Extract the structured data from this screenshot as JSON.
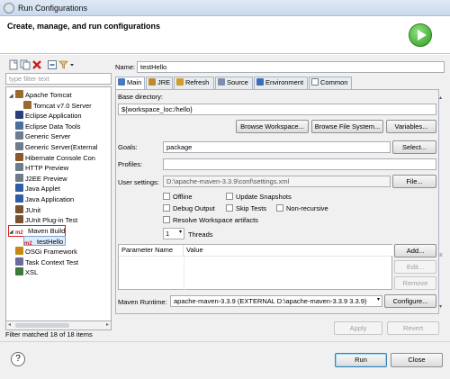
{
  "window": {
    "title": "Run Configurations"
  },
  "banner": {
    "heading": "Create, manage, and run configurations"
  },
  "left": {
    "filter_placeholder": "type filter text",
    "filter_status": "Filter matched 18 of 18 items",
    "tree": [
      {
        "label": "Apache Tomcat",
        "level": 1,
        "expanded": true,
        "icon_color": "#9a6b2f"
      },
      {
        "label": "Tomcat v7.0 Server",
        "level": 2,
        "icon_color": "#9a6b2f"
      },
      {
        "label": "Eclipse Application",
        "level": 1,
        "icon_color": "#2a3f7a"
      },
      {
        "label": "Eclipse Data Tools",
        "level": 1,
        "icon_color": "#4b6f9e"
      },
      {
        "label": "Generic Server",
        "level": 1,
        "icon_color": "#6f7c8c"
      },
      {
        "label": "Generic Server(External",
        "level": 1,
        "icon_color": "#6f7c8c"
      },
      {
        "label": "Hibernate Console Con",
        "level": 1,
        "icon_color": "#8b5a2b"
      },
      {
        "label": "HTTP Preview",
        "level": 1,
        "icon_color": "#6f7c8c"
      },
      {
        "label": "J2EE Preview",
        "level": 1,
        "icon_color": "#6f7c8c"
      },
      {
        "label": "Java Applet",
        "level": 1,
        "icon_color": "#2f5ea8"
      },
      {
        "label": "Java Application",
        "level": 1,
        "icon_color": "#2f5ea8"
      },
      {
        "label": "JUnit",
        "level": 1,
        "icon_color": "#7a5230"
      },
      {
        "label": "JUnit Plug-in Test",
        "level": 1,
        "icon_color": "#7a5230"
      },
      {
        "label": "Maven Build",
        "level": 1,
        "expanded": true,
        "icon_color": "#c02020",
        "icon_text": "m2"
      },
      {
        "label": "testHello",
        "level": 2,
        "selected": true,
        "icon_color": "#c02020",
        "icon_text": "m2"
      },
      {
        "label": "OSGi Framework",
        "level": 1,
        "icon_color": "#c48a18"
      },
      {
        "label": "Task Context Test",
        "level": 1,
        "icon_color": "#6b6b9e"
      },
      {
        "label": "XSL",
        "level": 1,
        "icon_color": "#3a7a3a"
      }
    ]
  },
  "config": {
    "name_label": "Name:",
    "name_value": "testHello",
    "tabs": [
      {
        "label": "Main",
        "icon_color": "#4a78b8",
        "selected": true
      },
      {
        "label": "JRE",
        "icon_color": "#c08a2a"
      },
      {
        "label": "Refresh",
        "icon_color": "#d39b28"
      },
      {
        "label": "Source",
        "icon_color": "#7a8fb0"
      },
      {
        "label": "Environment",
        "icon_color": "#3a6fbf"
      },
      {
        "label": "Common",
        "icon_color": "#6f7c8c"
      }
    ],
    "base_dir_label": "Base directory:",
    "base_dir_value": "${workspace_loc:/hello}",
    "browse_workspace": "Browse Workspace...",
    "browse_fs": "Browse File System...",
    "variables": "Variables...",
    "goals_label": "Goals:",
    "goals_value": "package",
    "select": "Select...",
    "profiles_label": "Profiles:",
    "profiles_value": "",
    "user_settings_label": "User settings:",
    "user_settings_value": "D:\\apache-maven-3.3.9\\conf\\settings.xml",
    "file_btn": "File...",
    "checks": {
      "offline": "Offline",
      "update_snapshots": "Update Snapshots",
      "debug_output": "Debug Output",
      "skip_tests": "Skip Tests",
      "non_recursive": "Non-recursive",
      "resolve_ws": "Resolve Workspace artifacts"
    },
    "threads_value": "1",
    "threads_label": "Threads",
    "param_col_name": "Parameter Name",
    "param_col_value": "Value",
    "add": "Add...",
    "edit": "Edit...",
    "remove": "Remove",
    "runtime_label": "Maven Runtime:",
    "runtime_value": "apache-maven-3.3.9 (EXTERNAL D:\\apache-maven-3.3.9 3.3.9)",
    "configure": "Configure...",
    "apply": "Apply",
    "revert": "Revert"
  },
  "footer": {
    "help": "?",
    "run": "Run",
    "close": "Close"
  },
  "colors": {
    "accent": "#3c7fb1",
    "selection_outline": "#e02020",
    "run_green": "#2f9a25"
  }
}
